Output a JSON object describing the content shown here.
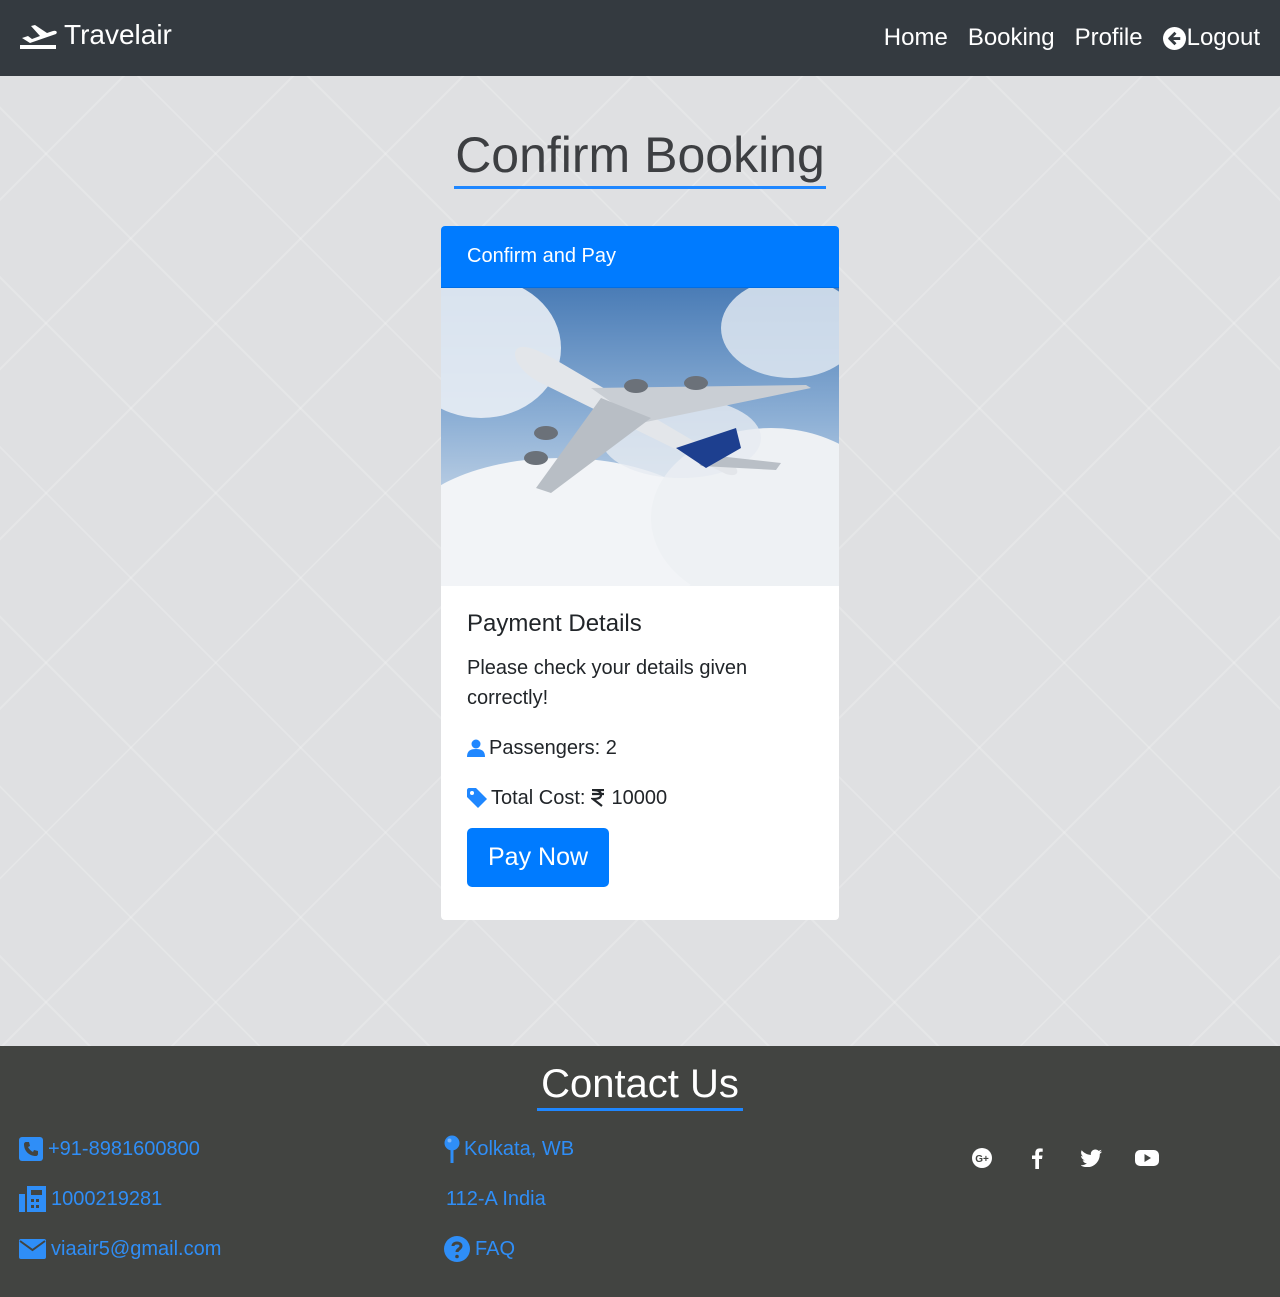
{
  "nav": {
    "brand": "Travelair",
    "links": [
      "Home",
      "Booking",
      "Profile"
    ],
    "logout": "Logout"
  },
  "page": {
    "title": "Confirm Booking"
  },
  "card": {
    "header": "Confirm and Pay",
    "title": "Payment Details",
    "text": "Please check your details given correctly!",
    "passengers": "Passengers: 2",
    "total_cost_label": "Total Cost:",
    "total_cost_value": "10000",
    "pay_button": "Pay Now"
  },
  "footer": {
    "title": "Contact Us",
    "phone": "+91-8981600800",
    "fax": "1000219281",
    "email": "viaair5@gmail.com",
    "city": "Kolkata, WB",
    "address": "112-A India",
    "faq": "FAQ",
    "social": [
      "google-plus-icon",
      "facebook-icon",
      "twitter-icon",
      "youtube-icon"
    ]
  },
  "colors": {
    "accent": "#007bff",
    "navbar": "#343a40",
    "footer": "#424441",
    "link": "#2f8ef7"
  }
}
